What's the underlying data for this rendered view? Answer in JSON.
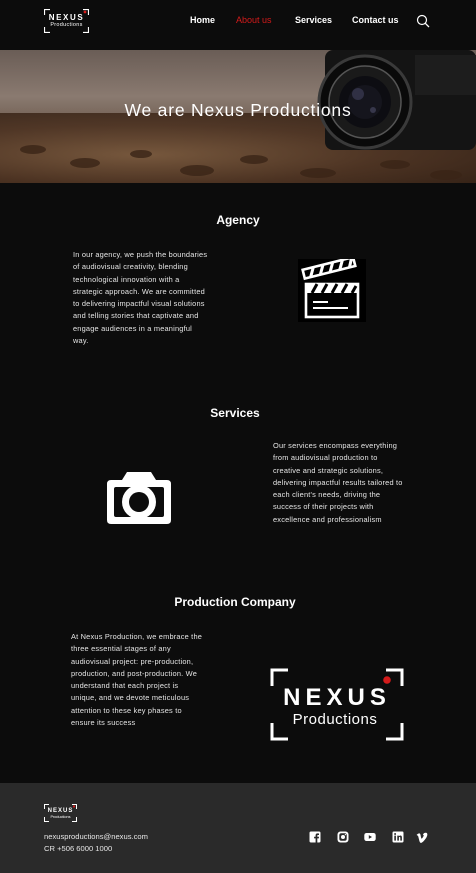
{
  "brand": {
    "name": "NEXUS",
    "sub": "Productions"
  },
  "nav": {
    "home": "Home",
    "about": "About us",
    "services": "Services",
    "contact": "Contact us"
  },
  "hero": {
    "title": "We are Nexus Productions"
  },
  "agency": {
    "title": "Agency",
    "text": "In our agency, we push the boundaries of audiovisual creativity, blending technological innovation with a strategic approach. We are committed to delivering impactful visual solutions and telling stories that captivate and engage audiences in a meaningful way."
  },
  "services": {
    "title": "Services",
    "text": "Our services encompass everything from audiovisual production to creative and strategic solutions, delivering impactful results tailored to each client's needs, driving the success of their projects with excellence and professionalism"
  },
  "production": {
    "title": "Production Company",
    "text": "At Nexus Production, we embrace the three essential stages of any audiovisual project: pre-production, production, and post-production. We understand that each project is unique, and we devote meticulous attention to these key phases to ensure its success"
  },
  "footer": {
    "email": "nexusproductions@nexus.com",
    "phone": "CR +506 6000 1000"
  },
  "colors": {
    "accent": "#d41b1b",
    "background": "#0c0c0c",
    "footer": "#2a2a2a"
  },
  "icons": [
    "search-icon",
    "clapperboard-icon",
    "camera-icon",
    "facebook-icon",
    "instagram-icon",
    "youtube-icon",
    "linkedin-icon",
    "vimeo-icon"
  ]
}
